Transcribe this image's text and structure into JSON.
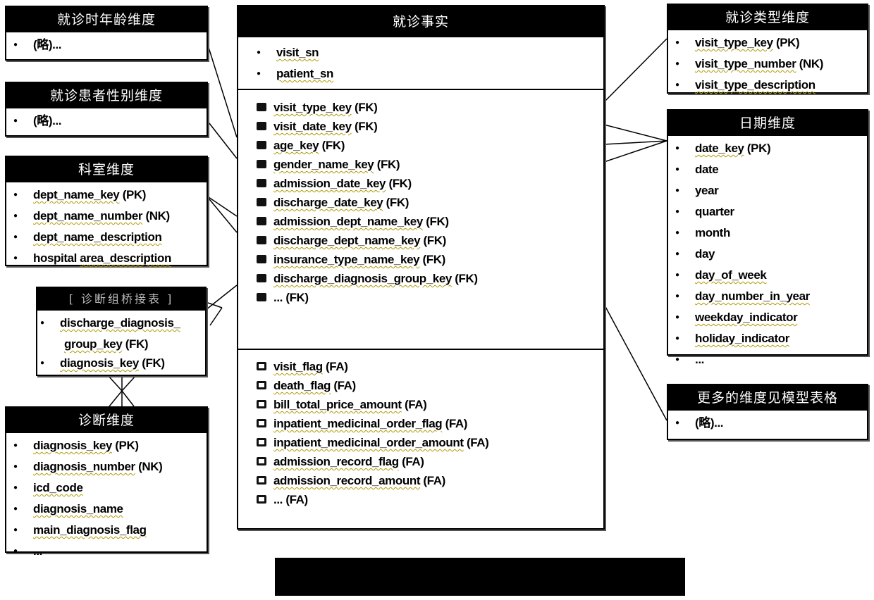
{
  "fact_table": {
    "title": "就诊事实",
    "keys": [
      "visit_sn",
      "patient_sn"
    ],
    "foreign_keys": [
      {
        "name": "visit_type_key",
        "tag": "(FK)"
      },
      {
        "name": "visit_date_key",
        "tag": "(FK)"
      },
      {
        "name": "age_key",
        "tag": "(FK)"
      },
      {
        "name": "gender_name_key",
        "tag": "(FK)"
      },
      {
        "name": "admission_date_key",
        "tag": "(FK)"
      },
      {
        "name": "discharge_date_key",
        "tag": "(FK)"
      },
      {
        "name": "admission_dept_name_key",
        "tag": "(FK)"
      },
      {
        "name": "discharge_dept_name_key",
        "tag": "(FK)"
      },
      {
        "name": "insurance_type_name_key",
        "tag": "(FK)"
      },
      {
        "name": "discharge_diagnosis_group_key",
        "tag": "(FK)"
      },
      {
        "name": "...",
        "tag": "(FK)"
      }
    ],
    "facts": [
      {
        "name": "visit_flag",
        "tag": "(FA)"
      },
      {
        "name": "death_flag",
        "tag": "(FA)"
      },
      {
        "name": "bill_total_price_amount",
        "tag": "(FA)"
      },
      {
        "name": "inpatient_medicinal_order_flag",
        "tag": "(FA)"
      },
      {
        "name": "inpatient_medicinal_order_amount",
        "tag": "(FA)"
      },
      {
        "name": "admission_record_flag",
        "tag": "(FA)"
      },
      {
        "name": "admission_record_amount",
        "tag": "(FA)"
      },
      {
        "name": "...",
        "tag": "(FA)"
      }
    ]
  },
  "age_dim": {
    "title": "就诊时年龄维度",
    "items": [
      "(略)..."
    ]
  },
  "gender_dim": {
    "title": "就诊患者性别维度",
    "items": [
      "(略)..."
    ]
  },
  "dept_dim": {
    "title": "科室维度",
    "items": [
      {
        "pre": "",
        "name": "dept_name_key",
        "tag": "(PK)"
      },
      {
        "pre": "",
        "name": "dept_name_number",
        "tag": "(NK)"
      },
      {
        "pre": "",
        "name": "dept_name_description",
        "tag": ""
      },
      {
        "pre": "hospital ",
        "name": "area_description",
        "tag": ""
      }
    ]
  },
  "bridge": {
    "title": "[ 诊断组桥接表 ]",
    "items": [
      {
        "name": "discharge_diagnosis_",
        "tag": ""
      },
      {
        "name": "group_key",
        "tag": "(FK)"
      },
      {
        "name": "diagnosis_key",
        "tag": "(FK)"
      }
    ]
  },
  "diagnosis_dim": {
    "title": "诊断维度",
    "items": [
      {
        "name": "diagnosis_key",
        "tag": "(PK)"
      },
      {
        "name": "diagnosis_number",
        "tag": "(NK)"
      },
      {
        "name": "icd_code",
        "tag": ""
      },
      {
        "name": "diagnosis_name",
        "tag": ""
      },
      {
        "name": "main_diagnosis_flag",
        "tag": ""
      },
      {
        "name": "...",
        "tag": ""
      }
    ]
  },
  "visit_type_dim": {
    "title": "就诊类型维度",
    "items": [
      {
        "name": "visit_type_key",
        "tag": "(PK)"
      },
      {
        "name": "visit_type_number",
        "tag": "(NK)"
      },
      {
        "name": "visit_type_description",
        "tag": ""
      }
    ]
  },
  "date_dim": {
    "title": "日期维度",
    "items": [
      {
        "name": "date_key",
        "tag": "(PK)",
        "u": true
      },
      {
        "name": "date",
        "tag": "",
        "u": false
      },
      {
        "name": "year",
        "tag": "",
        "u": false
      },
      {
        "name": "quarter",
        "tag": "",
        "u": false
      },
      {
        "name": "month",
        "tag": "",
        "u": false
      },
      {
        "name": "day",
        "tag": "",
        "u": false
      },
      {
        "name": "day_of_week",
        "tag": "",
        "u": true
      },
      {
        "name": "day_number_in_year",
        "tag": "",
        "u": true
      },
      {
        "name": "weekday_indicator",
        "tag": "",
        "u": true
      },
      {
        "name": "holiday_indicator",
        "tag": "",
        "u": true
      },
      {
        "name": "...",
        "tag": "",
        "u": false
      }
    ]
  },
  "more_dim": {
    "title": "更多的维度见模型表格",
    "items": [
      "(略)..."
    ]
  }
}
